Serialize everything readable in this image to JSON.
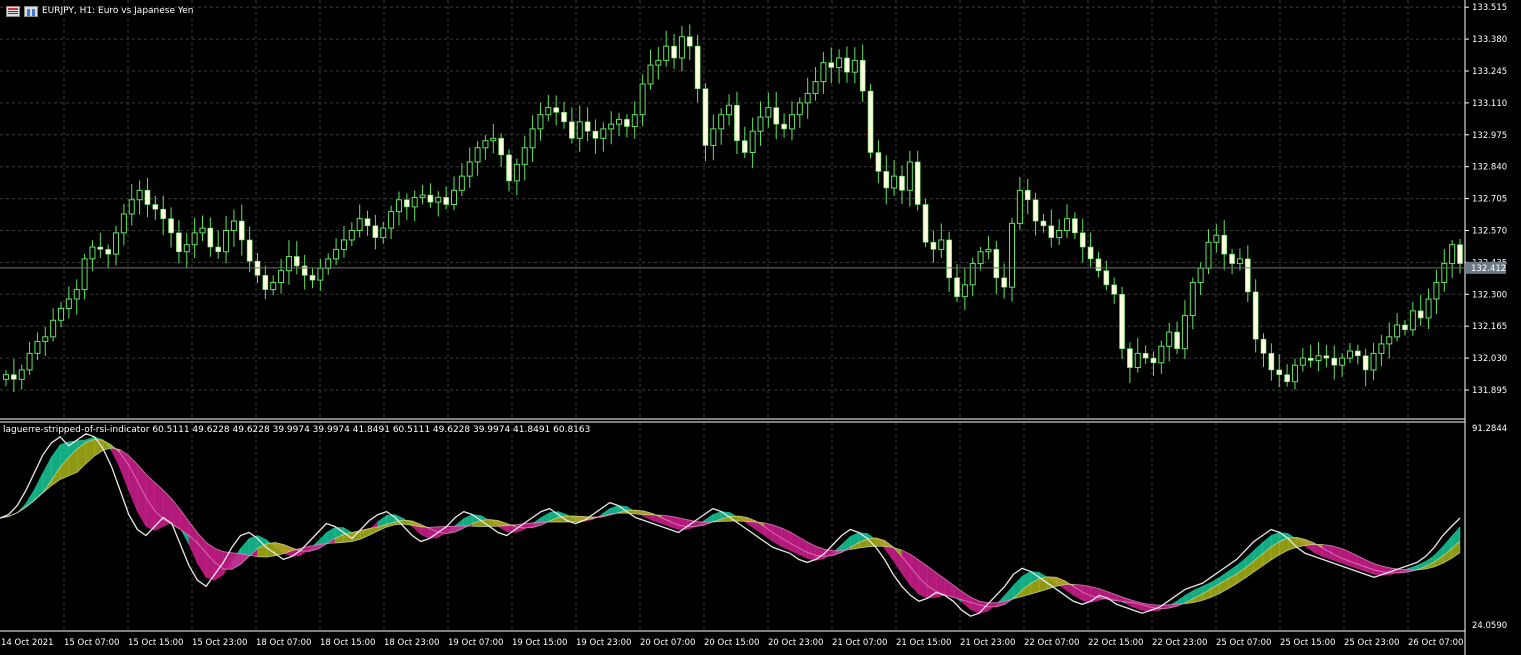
{
  "window": {
    "title": "EURJPY, H1:  Euro vs Japanese Yen",
    "symbol": "EURJPY",
    "timeframe": "H1"
  },
  "icons": [
    "window-list-icon",
    "trade-panel-icon"
  ],
  "colors": {
    "background": "#000000",
    "grid": "#3c3c3c",
    "bull_candle": "#ffffe0",
    "bear_candle": "#ffffe0",
    "wick": "#5fe35f",
    "price_line": "#707070",
    "price_tag_bg": "#6b7a86",
    "rsi_line": "#e8e8e8",
    "fill_magenta": "#d11f8f",
    "fill_olive": "#a8b418",
    "fill_teal": "#18c99a"
  },
  "price_panel": {
    "price_axis_labels": [
      "133.515",
      "133.380",
      "133.245",
      "133.110",
      "132.975",
      "132.840",
      "132.705",
      "132.570",
      "132.435",
      "132.300",
      "132.165",
      "132.030",
      "131.895"
    ],
    "current_price": "132.412"
  },
  "indicator_panel": {
    "label": "laguerre-stripped-of-rsi-indicator 60.5111 49.6228 49.6228 39.9974 39.9974 41.8491 60.5111 49.6228 39.9974 41.8491 60.8163",
    "axis_max": "91.2844",
    "axis_min": "24.0590"
  },
  "time_axis": [
    "14 Oct 2021",
    "15 Oct 07:00",
    "15 Oct 15:00",
    "15 Oct 23:00",
    "18 Oct 07:00",
    "18 Oct 15:00",
    "18 Oct 23:00",
    "19 Oct 07:00",
    "19 Oct 15:00",
    "19 Oct 23:00",
    "20 Oct 07:00",
    "20 Oct 15:00",
    "20 Oct 23:00",
    "21 Oct 07:00",
    "21 Oct 15:00",
    "21 Oct 23:00",
    "22 Oct 07:00",
    "22 Oct 15:00",
    "22 Oct 23:00",
    "25 Oct 07:00",
    "25 Oct 15:00",
    "25 Oct 23:00",
    "26 Oct 07:00"
  ],
  "chart_data": {
    "type": "candlestick",
    "price_range": [
      131.785,
      133.52
    ],
    "closes": [
      131.96,
      131.94,
      131.98,
      132.05,
      132.1,
      132.12,
      132.19,
      132.24,
      132.28,
      132.32,
      132.45,
      132.5,
      132.49,
      132.47,
      132.56,
      132.64,
      132.7,
      132.74,
      132.68,
      132.66,
      132.62,
      132.56,
      132.48,
      132.51,
      132.56,
      132.58,
      132.5,
      132.48,
      132.57,
      132.61,
      132.53,
      132.44,
      132.38,
      132.32,
      132.35,
      132.4,
      132.46,
      132.42,
      132.38,
      132.36,
      132.41,
      132.45,
      132.49,
      132.53,
      132.57,
      132.62,
      132.59,
      132.54,
      132.58,
      132.65,
      132.7,
      132.67,
      132.71,
      132.72,
      132.69,
      132.71,
      132.68,
      132.74,
      132.8,
      132.86,
      132.92,
      132.95,
      132.96,
      132.89,
      132.78,
      132.85,
      132.92,
      133.0,
      133.06,
      133.09,
      133.07,
      133.03,
      132.96,
      133.03,
      132.99,
      132.96,
      133.0,
      133.02,
      133.04,
      133.01,
      133.06,
      133.19,
      133.27,
      133.29,
      133.35,
      133.3,
      133.39,
      133.35,
      133.17,
      132.93,
      133.0,
      133.06,
      133.1,
      132.95,
      132.9,
      132.99,
      133.05,
      133.09,
      133.02,
      133.0,
      133.06,
      133.11,
      133.15,
      133.2,
      133.28,
      133.26,
      133.3,
      133.24,
      133.29,
      133.16,
      132.9,
      132.82,
      132.75,
      132.8,
      132.74,
      132.86,
      132.68,
      132.52,
      132.49,
      132.53,
      132.37,
      132.29,
      132.34,
      132.43,
      132.48,
      132.49,
      132.37,
      132.33,
      132.6,
      132.74,
      132.7,
      132.61,
      132.59,
      132.54,
      132.57,
      132.62,
      132.56,
      132.5,
      132.45,
      132.4,
      132.34,
      132.3,
      132.07,
      131.99,
      132.05,
      132.03,
      132.01,
      132.08,
      132.14,
      132.07,
      132.21,
      132.35,
      132.41,
      132.52,
      132.55,
      132.47,
      132.43,
      132.45,
      132.31,
      132.11,
      132.05,
      131.98,
      131.96,
      131.93,
      132.0,
      132.03,
      132.02,
      132.04,
      132.03,
      132.0,
      132.03,
      132.06,
      132.04,
      131.98,
      132.05,
      132.09,
      132.12,
      132.17,
      132.15,
      132.23,
      132.2,
      132.28,
      132.35,
      132.43,
      132.51,
      132.43
    ],
    "rsi_range": [
      24.059,
      91.2844
    ],
    "rsi": [
      60.8,
      62,
      65,
      70,
      76,
      82,
      86,
      88,
      85,
      87,
      89,
      88,
      84,
      78,
      70,
      62,
      57,
      55,
      58,
      61,
      59,
      52,
      45,
      40,
      38,
      42,
      46,
      51,
      55,
      56,
      54,
      51,
      49,
      47,
      48,
      50,
      53,
      56,
      59,
      58,
      56,
      54,
      57,
      60,
      62,
      63,
      61,
      58,
      55,
      53,
      54,
      56,
      58,
      61,
      63,
      62,
      60,
      58,
      56,
      55,
      57,
      59,
      61,
      63,
      64,
      62,
      60,
      59,
      60,
      62,
      64,
      66,
      65,
      63,
      61,
      60,
      59,
      58,
      57,
      56,
      58,
      60,
      62,
      64,
      63,
      61,
      59,
      57,
      55,
      53,
      51,
      50,
      49,
      47,
      46,
      47,
      49,
      52,
      55,
      57,
      56,
      54,
      51,
      47,
      42,
      38,
      35,
      33,
      34,
      36,
      35,
      33,
      30,
      28,
      29,
      32,
      35,
      38,
      42,
      44,
      43,
      41,
      39,
      37,
      35,
      33,
      32,
      33,
      35,
      34,
      32,
      31,
      30,
      29,
      30,
      31,
      33,
      35,
      37,
      38,
      39,
      41,
      43,
      45,
      47,
      50,
      53,
      55,
      57,
      56,
      54,
      51,
      49,
      48,
      47,
      46,
      45,
      44,
      43,
      42,
      41,
      42,
      43,
      44,
      45,
      46,
      48,
      51,
      55,
      58,
      60.8163
    ]
  }
}
